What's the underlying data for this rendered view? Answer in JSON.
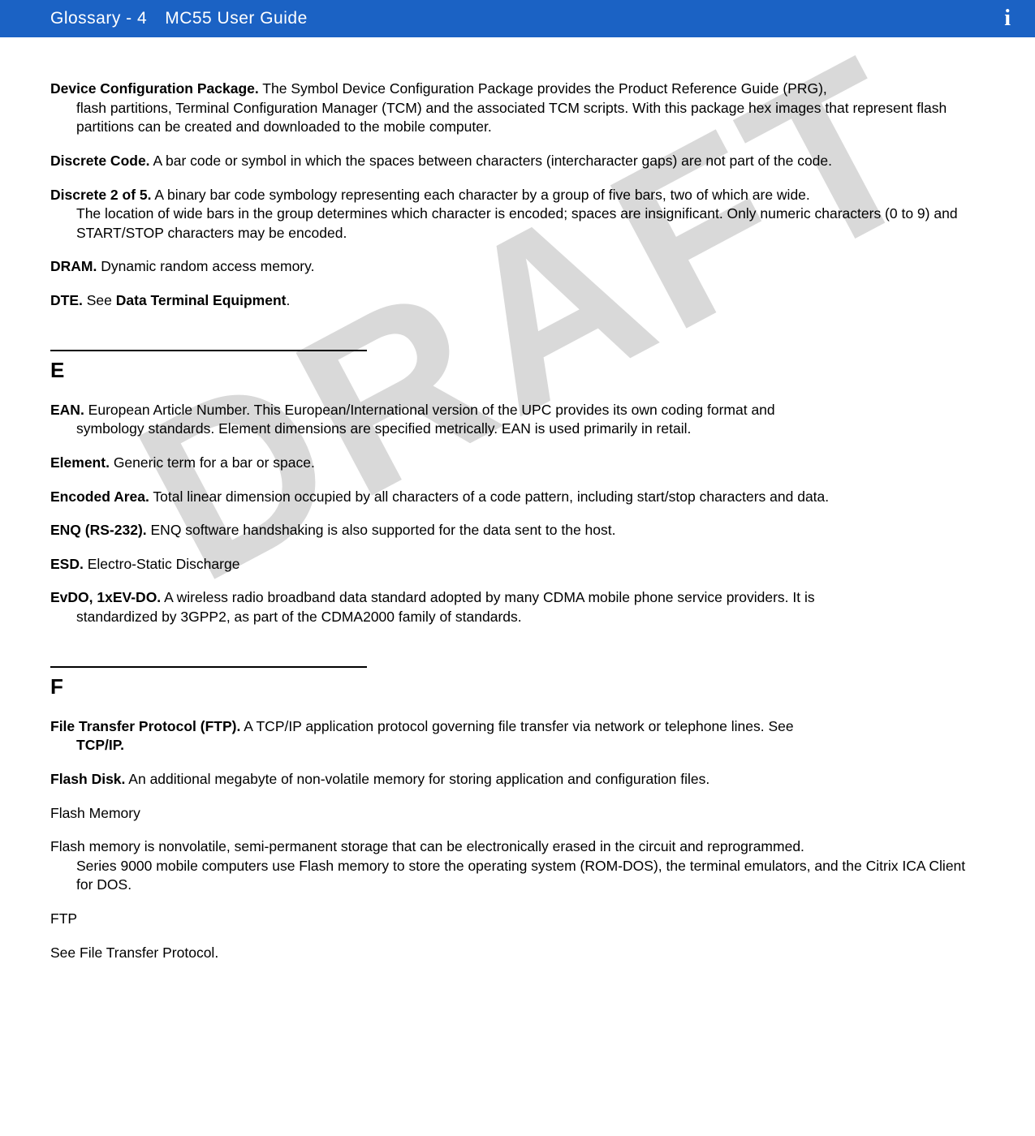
{
  "header": {
    "page_ref": "Glossary - 4",
    "guide_title": "MC55 User Guide",
    "corner_mark": "i"
  },
  "watermark": "DRAFT",
  "sections": {
    "d": {
      "entries": {
        "dcp": {
          "term": "Device Configuration Package.",
          "first": " The Symbol Device Configuration Package provides the Product Reference Guide (PRG),",
          "cont": "flash partitions, Terminal Configuration Manager (TCM) and the associated TCM scripts. With this package hex images that represent flash partitions can be created and downloaded to the mobile computer."
        },
        "discrete_code": {
          "term": "Discrete Code.",
          "def": " A bar code or symbol in which the spaces between characters (intercharacter gaps) are not part of the code."
        },
        "d2of5": {
          "term": "Discrete 2 of 5.",
          "first": " A binary bar code symbology representing each character by a group of five bars, two of which are wide.",
          "cont": "The location of wide bars in the group determines which character is encoded; spaces are insignificant. Only numeric characters (0 to 9) and START/STOP characters may be encoded."
        },
        "dram": {
          "term": "DRAM.",
          "def": " Dynamic random access memory."
        },
        "dte": {
          "term": "DTE.",
          "pre": " See ",
          "ref": "Data Terminal Equipment",
          "post": "."
        }
      }
    },
    "e": {
      "letter": "E",
      "entries": {
        "ean": {
          "term": "EAN.",
          "first": " European Article Number. This European/International version of the UPC provides its own coding format and",
          "cont": "symbology standards. Element dimensions are specified metrically. EAN is used primarily in retail."
        },
        "element": {
          "term": "Element.",
          "def": " Generic term for a bar or space."
        },
        "encoded_area": {
          "term": "Encoded Area.",
          "def": " Total linear dimension occupied by all characters of a code pattern, including start/stop characters and data."
        },
        "enq": {
          "term": "ENQ (RS-232).",
          "def": " ENQ software handshaking is also supported for the data sent to the host."
        },
        "esd": {
          "term": "ESD.",
          "def": " Electro-Static Discharge"
        },
        "evdo": {
          "term": "EvDO, 1xEV-DO.",
          "first": " A wireless radio broadband data standard adopted by many CDMA mobile phone service providers. It is",
          "cont": "standardized by 3GPP2, as part of the CDMA2000 family of standards."
        }
      }
    },
    "f": {
      "letter": "F",
      "entries": {
        "ftp_def": {
          "term": "File Transfer Protocol (FTP).",
          "first": " A TCP/IP application protocol governing file transfer via network or telephone lines. See",
          "cont_bold": "TCP/IP."
        },
        "flash_disk": {
          "term": "Flash Disk.",
          "def": " An additional megabyte of non-volatile memory for storing application and configuration files."
        },
        "flash_memory_h": "Flash Memory",
        "flash_memory_body": {
          "first": "Flash memory is nonvolatile, semi-permanent storage that can be electronically erased in the circuit and reprogrammed.",
          "cont": "Series 9000 mobile computers use Flash memory to store the operating system (ROM-DOS), the terminal emulators, and the Citrix ICA Client for DOS."
        },
        "ftp_h": "FTP",
        "ftp_ref": {
          "pre": "See ",
          "ref": "File Transfer Protocol",
          "post": "."
        }
      }
    }
  }
}
